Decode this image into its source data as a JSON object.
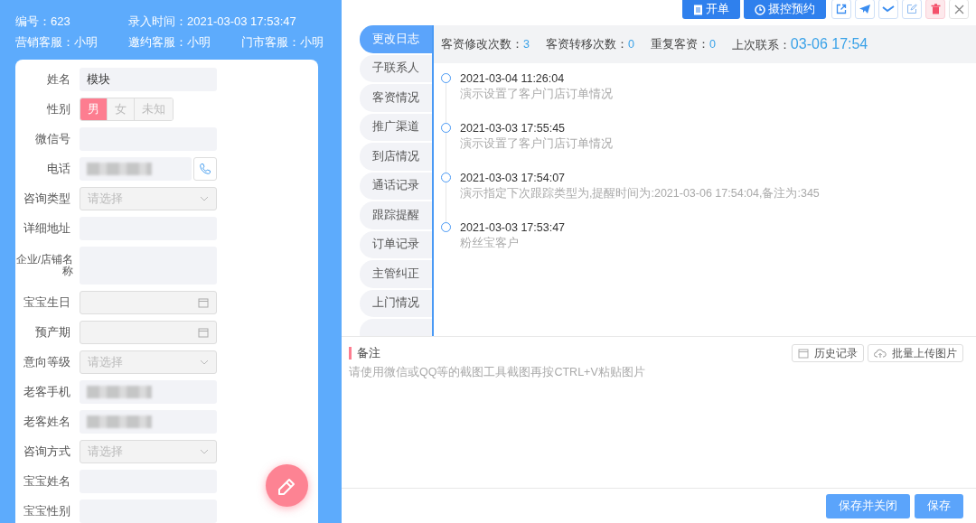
{
  "header": {
    "rows": [
      [
        {
          "label": "编号：",
          "value": "623"
        },
        {
          "label": "录入时间：",
          "value": "2021-03-03 17:53:47"
        }
      ],
      [
        {
          "label": "营销客服：",
          "value": "小明"
        },
        {
          "label": "邀约客服：",
          "value": "小明"
        },
        {
          "label": "门市客服：",
          "value": "小明"
        }
      ]
    ]
  },
  "form": {
    "fields": [
      {
        "label": "姓名",
        "kind": "text",
        "value": "模块"
      },
      {
        "label": "性别",
        "kind": "gender",
        "options": [
          {
            "label": "男",
            "selected": true
          },
          {
            "label": "女",
            "selected": false
          },
          {
            "label": "未知",
            "selected": false
          }
        ]
      },
      {
        "label": "微信号",
        "kind": "text"
      },
      {
        "label": "电话",
        "kind": "phone",
        "masked": true
      },
      {
        "label": "咨询类型",
        "kind": "select",
        "placeholder": "请选择"
      },
      {
        "label": "详细地址",
        "kind": "text"
      },
      {
        "label": "企业/店铺名称",
        "kind": "textarea"
      },
      {
        "label": "宝宝生日",
        "kind": "date"
      },
      {
        "label": "预产期",
        "kind": "date"
      },
      {
        "label": "意向等级",
        "kind": "select",
        "placeholder": "请选择"
      },
      {
        "label": "老客手机",
        "kind": "text",
        "masked": true
      },
      {
        "label": "老客姓名",
        "kind": "text",
        "masked": true
      },
      {
        "label": "咨询方式",
        "kind": "select",
        "placeholder": "请选择"
      },
      {
        "label": "宝宝姓名",
        "kind": "text"
      },
      {
        "label": "宝宝性别",
        "kind": "text"
      }
    ]
  },
  "toolbar": {
    "buttons": [
      {
        "label": "开单",
        "kind": "doc"
      },
      {
        "label": "摄控预约",
        "kind": "clock"
      }
    ],
    "icons": [
      {
        "kind": "external"
      },
      {
        "kind": "send"
      },
      {
        "kind": "wave"
      },
      {
        "kind": "edit"
      },
      {
        "kind": "trash"
      },
      {
        "kind": "close"
      }
    ]
  },
  "tabs": [
    {
      "label": "更改日志",
      "selected": true
    },
    {
      "label": "子联系人",
      "selected": false
    },
    {
      "label": "客资情况",
      "selected": false
    },
    {
      "label": "推广渠道",
      "selected": false
    },
    {
      "label": "到店情况",
      "selected": false
    },
    {
      "label": "通话记录",
      "selected": false
    },
    {
      "label": "跟踪提醒",
      "selected": false
    },
    {
      "label": "订单记录",
      "selected": false
    },
    {
      "label": "主管纠正",
      "selected": false
    },
    {
      "label": "上门情况",
      "selected": false
    }
  ],
  "stats": [
    {
      "label": "客资修改次数：",
      "value": "3",
      "large": false
    },
    {
      "label": "客资转移次数：",
      "value": "0",
      "large": false
    },
    {
      "label": "重复客资：",
      "value": "0",
      "large": false
    },
    {
      "label": "上次联系：",
      "value": "03-06 17:54",
      "large": true
    }
  ],
  "timeline": [
    {
      "time": "2021-03-04 11:26:04",
      "text": "演示设置了客户门店订单情况"
    },
    {
      "time": "2021-03-03 17:55:45",
      "text": "演示设置了客户门店订单情况"
    },
    {
      "time": "2021-03-03 17:54:07",
      "text": "演示指定下次跟踪类型为,提醒时间为:2021-03-06 17:54:04,备注为:345"
    },
    {
      "time": "2021-03-03 17:53:47",
      "text": "粉丝宝客户"
    }
  ],
  "note": {
    "title": "备注",
    "placeholder": "请使用微信或QQ等的截图工具截图再按CTRL+V粘贴图片",
    "buttons": [
      {
        "label": "历史记录",
        "kind": "calendar"
      },
      {
        "label": "批量上传图片",
        "kind": "upload"
      }
    ]
  },
  "footer": {
    "buttons": [
      {
        "label": "保存并关闭"
      },
      {
        "label": "保存"
      }
    ]
  }
}
